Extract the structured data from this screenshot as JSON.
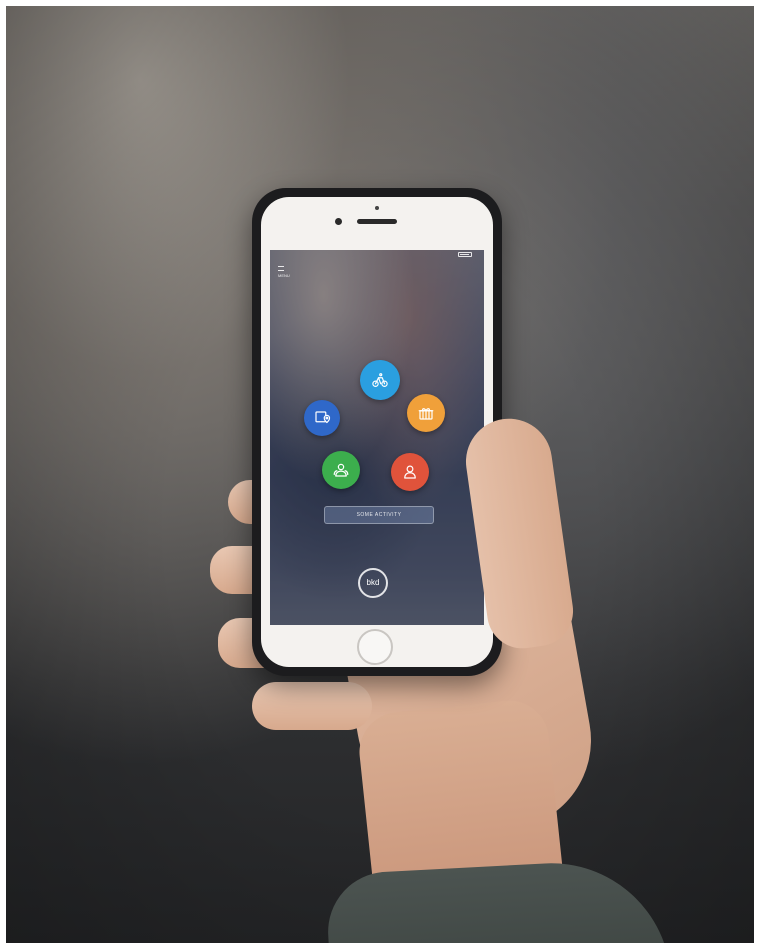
{
  "screen": {
    "status_time": "",
    "menu_label": "MENU",
    "location": "",
    "activity_button": "SOME ACTIVITY",
    "brand_logo": "bkd"
  },
  "actions": [
    {
      "name": "bike-action-button",
      "icon": "bike-icon",
      "color": "#2a9fe0"
    },
    {
      "name": "map-location-button",
      "icon": "map-pin-icon",
      "color": "#2f68c9"
    },
    {
      "name": "gift-button",
      "icon": "gift-icon",
      "color": "#f0a03a"
    },
    {
      "name": "group-button",
      "icon": "group-icon",
      "color": "#3cae4d"
    },
    {
      "name": "profile-button",
      "icon": "user-icon",
      "color": "#e0533b"
    }
  ]
}
